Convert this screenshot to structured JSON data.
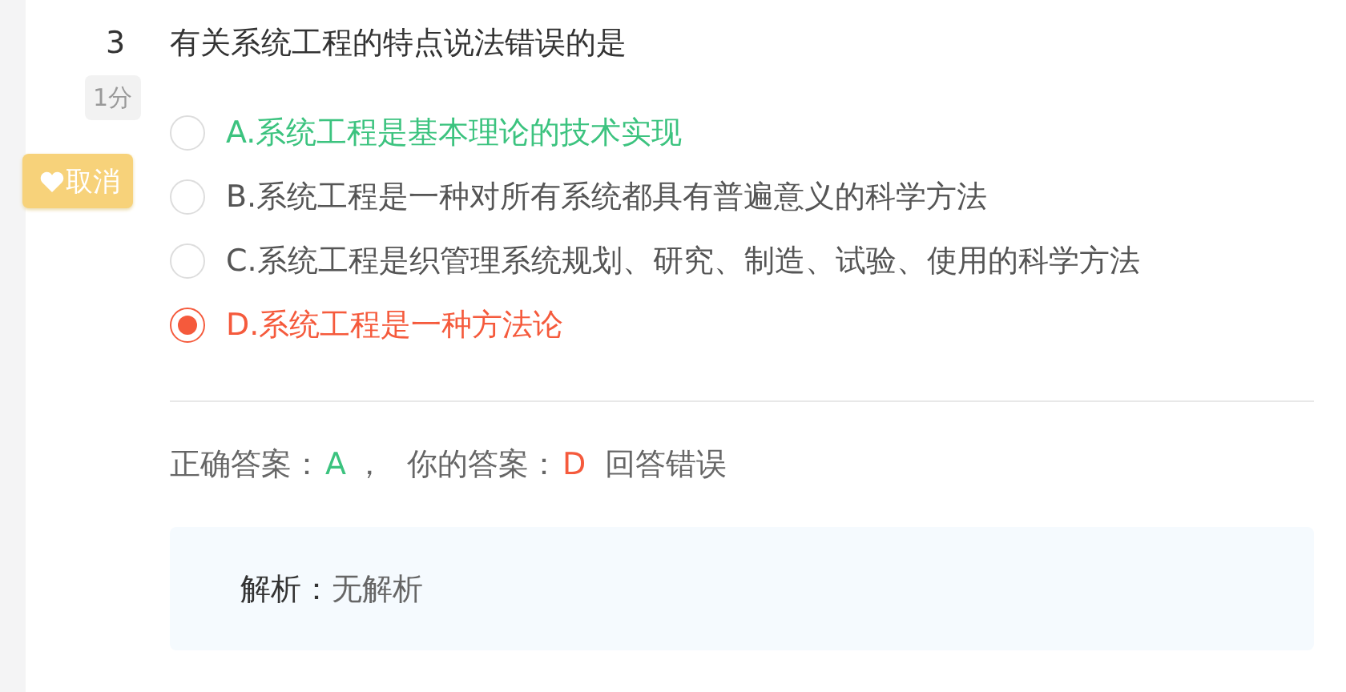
{
  "question": {
    "number": "3",
    "score": "1分",
    "text": "有关系统工程的特点说法错误的是"
  },
  "favorite_button": {
    "label": "取消"
  },
  "options": [
    {
      "text": "A.系统工程是基本理论的技术实现",
      "selected": false,
      "kind": "correct"
    },
    {
      "text": "B.系统工程是一种对所有系统都具有普遍意义的科学方法",
      "selected": false,
      "kind": "plain"
    },
    {
      "text": "C.系统工程是织管理系统规划、研究、制造、试验、使用的科学方法",
      "selected": false,
      "kind": "plain"
    },
    {
      "text": "D.系统工程是一种方法论",
      "selected": true,
      "kind": "wrong"
    }
  ],
  "answer": {
    "correct_label": "正确答案：",
    "correct_value": "A",
    "separator": "，",
    "your_label": "你的答案：",
    "your_value": "D",
    "verdict": "回答错误"
  },
  "analysis": {
    "label": "解析：",
    "text": "无解析"
  }
}
